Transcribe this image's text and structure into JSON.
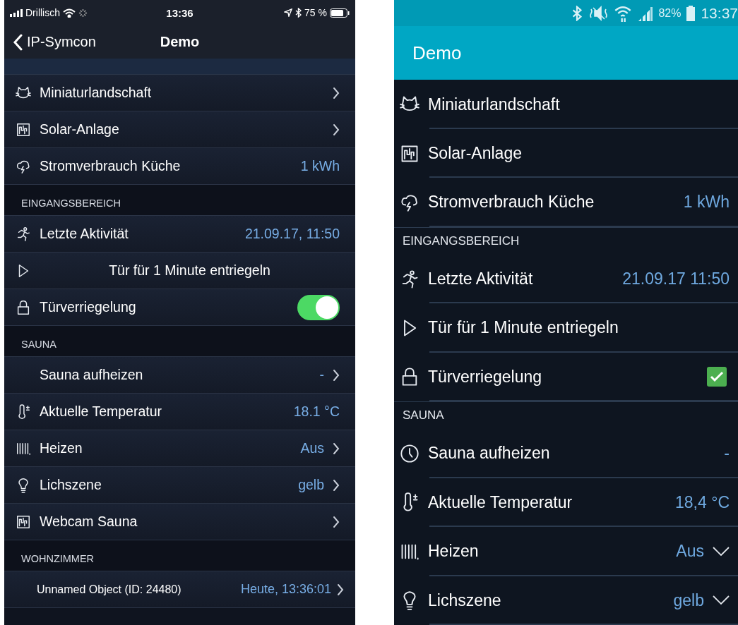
{
  "ios": {
    "status_bar": {
      "carrier": "Drillisch",
      "time": "13:36",
      "battery": "75 %"
    },
    "nav": {
      "back": "IP-Symcon",
      "title": "Demo"
    },
    "items": [
      {
        "kind": "link",
        "label": "Miniaturlandschaft"
      },
      {
        "kind": "link",
        "label": "Solar-Anlage"
      },
      {
        "kind": "value",
        "label": "Stromverbrauch Küche",
        "value": "1 kWh"
      },
      {
        "kind": "header",
        "label": "EINGANGSBEREICH"
      },
      {
        "kind": "value",
        "label": "Letzte Aktivität",
        "value": "21.09.17, 11:50"
      },
      {
        "kind": "button",
        "label": "Tür für 1 Minute entriegeln"
      },
      {
        "kind": "toggle",
        "label": "Türverriegelung",
        "on": true
      },
      {
        "kind": "header",
        "label": "SAUNA"
      },
      {
        "kind": "link",
        "label": "Sauna aufheizen",
        "value": "-"
      },
      {
        "kind": "value",
        "label": "Aktuelle Temperatur",
        "value": "18.1 °C"
      },
      {
        "kind": "link",
        "label": "Heizen",
        "value": "Aus"
      },
      {
        "kind": "link",
        "label": "Lichszene",
        "value": "gelb"
      },
      {
        "kind": "link",
        "label": "Webcam Sauna"
      },
      {
        "kind": "header",
        "label": "WOHNZIMMER"
      },
      {
        "kind": "link",
        "label": "Unnamed Object (ID: 24480)",
        "value": "Heute, 13:36:01"
      }
    ]
  },
  "android": {
    "status_bar": {
      "battery": "82%",
      "time": "13:37"
    },
    "app_bar": {
      "title": "Demo"
    },
    "items": [
      {
        "kind": "plain",
        "label": "Miniaturlandschaft"
      },
      {
        "kind": "plain",
        "label": "Solar-Anlage"
      },
      {
        "kind": "value",
        "label": "Stromverbrauch Küche",
        "value": "1 kWh"
      },
      {
        "kind": "header",
        "label": "EINGANGSBEREICH"
      },
      {
        "kind": "value",
        "label": "Letzte Aktivität",
        "value": "21.09.17 11:50"
      },
      {
        "kind": "plain",
        "label": "Tür für 1 Minute entriegeln"
      },
      {
        "kind": "checkbox",
        "label": "Türverriegelung",
        "checked": true
      },
      {
        "kind": "header",
        "label": "SAUNA"
      },
      {
        "kind": "value",
        "label": "Sauna aufheizen",
        "value": "-"
      },
      {
        "kind": "value",
        "label": "Aktuelle Temperatur",
        "value": "18,4 °C"
      },
      {
        "kind": "select",
        "label": "Heizen",
        "value": "Aus"
      },
      {
        "kind": "select",
        "label": "Lichszene",
        "value": "gelb"
      }
    ]
  }
}
